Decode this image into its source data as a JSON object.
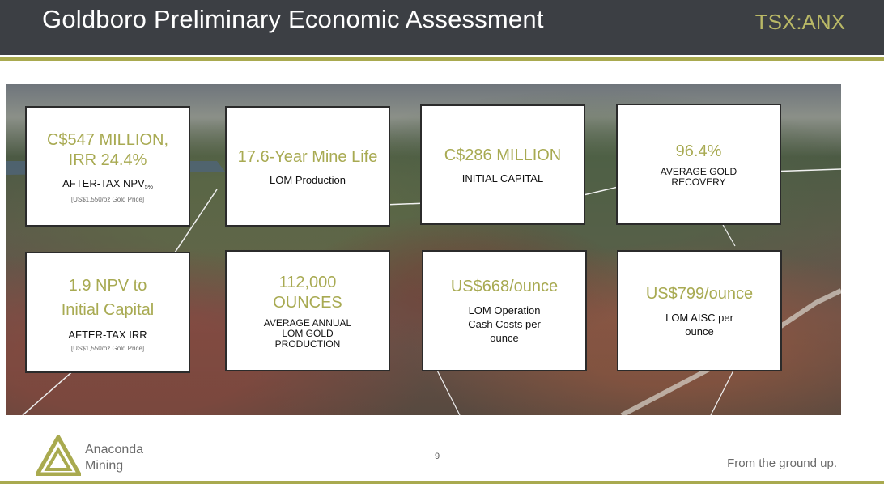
{
  "header": {
    "title": "Goldboro Preliminary Economic Assessment",
    "ticker": "TSX:ANX"
  },
  "cards": [
    {
      "value": "C$547 MILLION, IRR 24.4%",
      "label": "AFTER-TAX NPV",
      "label_sub": "5%",
      "note": "[US$1,550/oz Gold Price]"
    },
    {
      "value": "17.6-Year Mine Life",
      "label": "LOM Production"
    },
    {
      "value": "C$286 MILLION",
      "label": "INITIAL CAPITAL"
    },
    {
      "value": "96.4%",
      "label": "AVERAGE GOLD RECOVERY"
    },
    {
      "value": "1.9 NPV to Initial Capital",
      "label": "AFTER-TAX IRR",
      "note": "[US$1,550/oz Gold Price]"
    },
    {
      "value": "112,000 OUNCES",
      "label": "AVERAGE ANNUAL LOM GOLD PRODUCTION"
    },
    {
      "value": "US$668/ounce",
      "label": "LOM Operation Cash Costs per ounce"
    },
    {
      "value": "US$799/ounce",
      "label": "LOM AISC per ounce"
    }
  ],
  "footer": {
    "company_line1": "Anaconda",
    "company_line2": "Mining",
    "page_number": "9",
    "tagline": "From the ground up."
  },
  "colors": {
    "accent": "#a9aa4f",
    "header_bg": "#3c3f44",
    "value_text": "#a8aa52"
  },
  "icons": {
    "logo": "anaconda-triangle-logo"
  }
}
